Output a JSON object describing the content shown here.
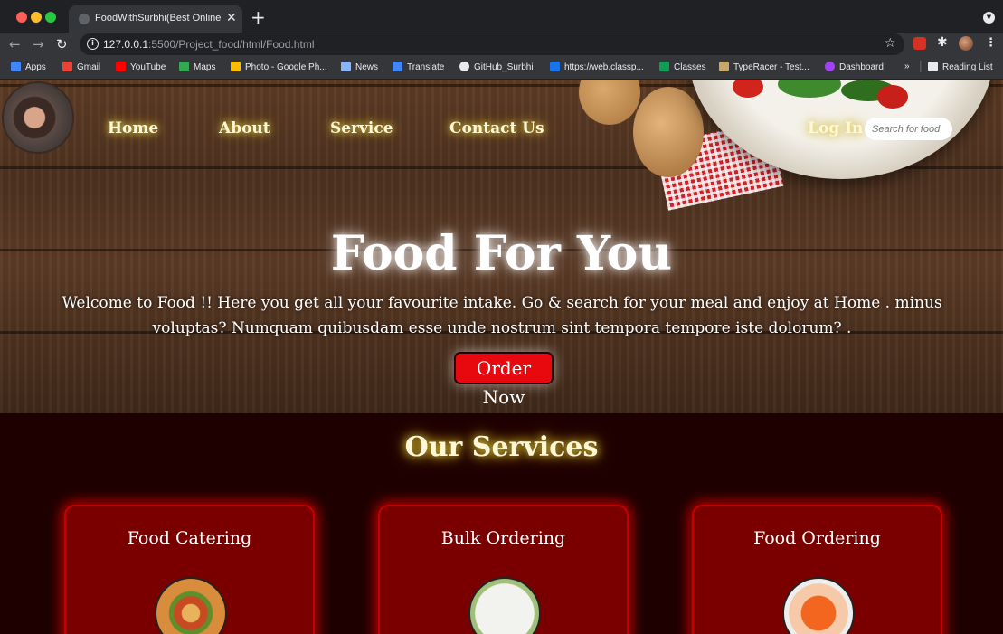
{
  "browser": {
    "tab_title": "FoodWithSurbhi(Best Online Fo",
    "url_host": "127.0.0.1",
    "url_path": ":5500/Project_food/html/Food.html",
    "bookmarks": [
      "Apps",
      "Gmail",
      "YouTube",
      "Maps",
      "Photo - Google Ph...",
      "News",
      "Translate",
      "GitHub_Surbhi",
      "https://web.classp...",
      "Classes",
      "TypeRacer - Test...",
      "Dashboard"
    ],
    "more_bookmarks": "»",
    "reading_list": "Reading List"
  },
  "nav": {
    "home": "Home",
    "about": "About",
    "service": "Service",
    "contact": "Contact Us",
    "login": "Log In",
    "search_placeholder": "Search for food"
  },
  "hero": {
    "title": "Food For You",
    "text": "Welcome to Food !! Here you get all your favourite intake. Go & search for your meal and enjoy at Home . minus voluptas? Numquam quibusdam esse unde nostrum sint tempora tempore iste dolorum? .",
    "button": "Order Now"
  },
  "services": {
    "title": "Our Services",
    "cards": [
      {
        "title": "Food Catering"
      },
      {
        "title": "Bulk Ordering"
      },
      {
        "title": "Food Ordering"
      }
    ]
  },
  "colors": {
    "nav_glow": "#e7d04b",
    "button_red": "#e8090f",
    "services_bg": "#1e0000",
    "card_bg": "#7a0000",
    "card_glow": "#e60000"
  }
}
